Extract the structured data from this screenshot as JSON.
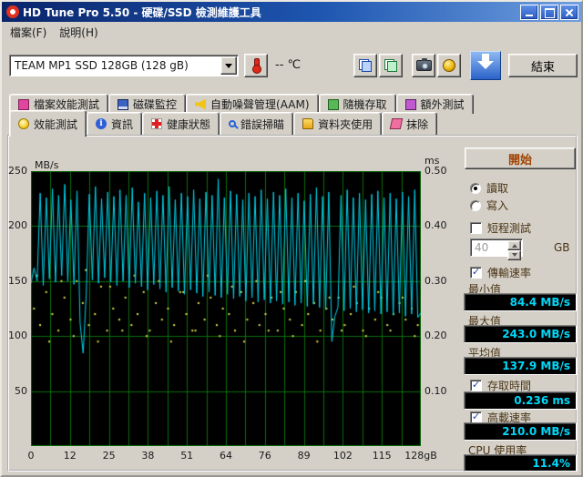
{
  "window": {
    "title": "HD Tune Pro 5.50 - 硬碟/SSD 檢測維護工具"
  },
  "menu": {
    "items": [
      "檔案(F)",
      "說明(H)"
    ]
  },
  "toolbar": {
    "drive": "TEAM MP1 SSD 128GB (128 gB)",
    "temp_value": "--",
    "temp_unit": "℃",
    "exit": "結束"
  },
  "tabs": {
    "row1": [
      "檔案效能測試",
      "磁碟監控",
      "自動噪聲管理(AAM)",
      "隨機存取",
      "額外測試"
    ],
    "row2": [
      "效能測試",
      "資訊",
      "健康狀態",
      "錯誤掃瞄",
      "資料夾使用",
      "抹除"
    ],
    "active": "效能測試"
  },
  "panel": {
    "start": "開始",
    "read": "讀取",
    "write": "寫入",
    "read_selected": true,
    "write_selected": false,
    "short_test": "短程測試",
    "short_test_checked": false,
    "short_value": "40",
    "short_unit": "GB",
    "transfer_rate": "傳輸速率",
    "transfer_rate_checked": true,
    "min_label": "最小值",
    "min_value": "84.4 MB/s",
    "max_label": "最大值",
    "max_value": "243.0 MB/s",
    "avg_label": "平均值",
    "avg_value": "137.9 MB/s",
    "access_label": "存取時間",
    "access_checked": true,
    "access_value": "0.236 ms",
    "burst_label": "高載速率",
    "burst_checked": true,
    "burst_value": "210.0 MB/s",
    "cpu_label": "CPU 使用率",
    "cpu_value": "11.4%"
  },
  "chart_data": {
    "type": "line",
    "bg": "#000000",
    "grid": {
      "color": "#0b6e0b",
      "x_divisions": 20,
      "y_divisions": 5
    },
    "x_range": [
      0,
      128
    ],
    "y_left_range": [
      0,
      250
    ],
    "y_right_range": [
      0,
      0.5
    ],
    "y_left_unit": "MB/s",
    "y_right_unit": "ms",
    "y_left_ticks": [
      "250",
      "200",
      "150",
      "100",
      "50"
    ],
    "y_right_ticks": [
      "0.50",
      "0.40",
      "0.30",
      "0.20",
      "0.10"
    ],
    "x_ticks": [
      "0",
      "12",
      "25",
      "38",
      "51",
      "64",
      "76",
      "89",
      "102",
      "115",
      "128gB"
    ],
    "series": [
      {
        "name": "transfer_rate",
        "color": "#00d4ee",
        "values": [
          148,
          162,
          150,
          230,
          146,
          226,
          152,
          234,
          149,
          228,
          155,
          238,
          150,
          224,
          147,
          232,
          112,
          84.4,
          138,
          229,
          151,
          236,
          148,
          225,
          153,
          231,
          149,
          227,
          146,
          233,
          150,
          228,
          144,
          235,
          148,
          222,
          145,
          230,
          142,
          226,
          147,
          232,
          143,
          228,
          140,
          236,
          144,
          224,
          141,
          230,
          138,
          227,
          142,
          233,
          139,
          225,
          136,
          231,
          140,
          228,
          137,
          243,
          135,
          226,
          138,
          232,
          134,
          229,
          136,
          224,
          132,
          230,
          135,
          227,
          131,
          233,
          133,
          225,
          130,
          231,
          132,
          228,
          129,
          234,
          131,
          226,
          128,
          230,
          130,
          223,
          127,
          229,
          129,
          235,
          126,
          227,
          124,
          231,
          95,
          118,
          126,
          228,
          123,
          233,
          125,
          226,
          122,
          230,
          124,
          224,
          121,
          229,
          123,
          232,
          120,
          226,
          122,
          230,
          119,
          225,
          121,
          231,
          118,
          227,
          120,
          233,
          117,
          121
        ]
      },
      {
        "name": "access_time",
        "color": "#dde24a",
        "points": [
          [
            1,
            0.25
          ],
          [
            3,
            0.22
          ],
          [
            5,
            0.28
          ],
          [
            7,
            0.24
          ],
          [
            9,
            0.21
          ],
          [
            11,
            0.27
          ],
          [
            13,
            0.23
          ],
          [
            15,
            0.3
          ],
          [
            17,
            0.26
          ],
          [
            19,
            0.22
          ],
          [
            21,
            0.24
          ],
          [
            23,
            0.29
          ],
          [
            25,
            0.21
          ],
          [
            27,
            0.25
          ],
          [
            29,
            0.23
          ],
          [
            31,
            0.27
          ],
          [
            33,
            0.22
          ],
          [
            35,
            0.24
          ],
          [
            37,
            0.28
          ],
          [
            39,
            0.21
          ],
          [
            41,
            0.26
          ],
          [
            43,
            0.23
          ],
          [
            45,
            0.25
          ],
          [
            47,
            0.22
          ],
          [
            49,
            0.28
          ],
          [
            51,
            0.24
          ],
          [
            53,
            0.21
          ],
          [
            55,
            0.26
          ],
          [
            57,
            0.23
          ],
          [
            59,
            0.27
          ],
          [
            61,
            0.22
          ],
          [
            63,
            0.25
          ],
          [
            65,
            0.24
          ],
          [
            67,
            0.21
          ],
          [
            69,
            0.28
          ],
          [
            71,
            0.23
          ],
          [
            73,
            0.26
          ],
          [
            75,
            0.22
          ],
          [
            77,
            0.24
          ],
          [
            79,
            0.27
          ],
          [
            81,
            0.21
          ],
          [
            83,
            0.25
          ],
          [
            85,
            0.23
          ],
          [
            87,
            0.28
          ],
          [
            89,
            0.22
          ],
          [
            91,
            0.24
          ],
          [
            93,
            0.26
          ],
          [
            95,
            0.21
          ],
          [
            97,
            0.25
          ],
          [
            99,
            0.23
          ],
          [
            101,
            0.27
          ],
          [
            103,
            0.22
          ],
          [
            105,
            0.24
          ],
          [
            107,
            0.26
          ],
          [
            109,
            0.21
          ],
          [
            111,
            0.25
          ],
          [
            113,
            0.23
          ],
          [
            115,
            0.27
          ],
          [
            117,
            0.22
          ],
          [
            119,
            0.24
          ],
          [
            121,
            0.26
          ],
          [
            123,
            0.23
          ],
          [
            125,
            0.25
          ],
          [
            127,
            0.22
          ],
          [
            2,
            0.31
          ],
          [
            6,
            0.19
          ],
          [
            10,
            0.3
          ],
          [
            14,
            0.2
          ],
          [
            18,
            0.32
          ],
          [
            22,
            0.19
          ],
          [
            26,
            0.29
          ],
          [
            30,
            0.21
          ],
          [
            34,
            0.31
          ],
          [
            38,
            0.2
          ],
          [
            42,
            0.3
          ],
          [
            46,
            0.19
          ],
          [
            50,
            0.28
          ],
          [
            54,
            0.21
          ],
          [
            58,
            0.31
          ],
          [
            62,
            0.2
          ],
          [
            66,
            0.29
          ],
          [
            70,
            0.19
          ],
          [
            74,
            0.3
          ],
          [
            78,
            0.21
          ],
          [
            82,
            0.28
          ],
          [
            86,
            0.2
          ],
          [
            90,
            0.3
          ],
          [
            94,
            0.19
          ],
          [
            98,
            0.27
          ],
          [
            102,
            0.21
          ],
          [
            106,
            0.29
          ],
          [
            110,
            0.2
          ],
          [
            114,
            0.28
          ],
          [
            118,
            0.21
          ],
          [
            122,
            0.27
          ],
          [
            126,
            0.2
          ]
        ]
      }
    ]
  }
}
